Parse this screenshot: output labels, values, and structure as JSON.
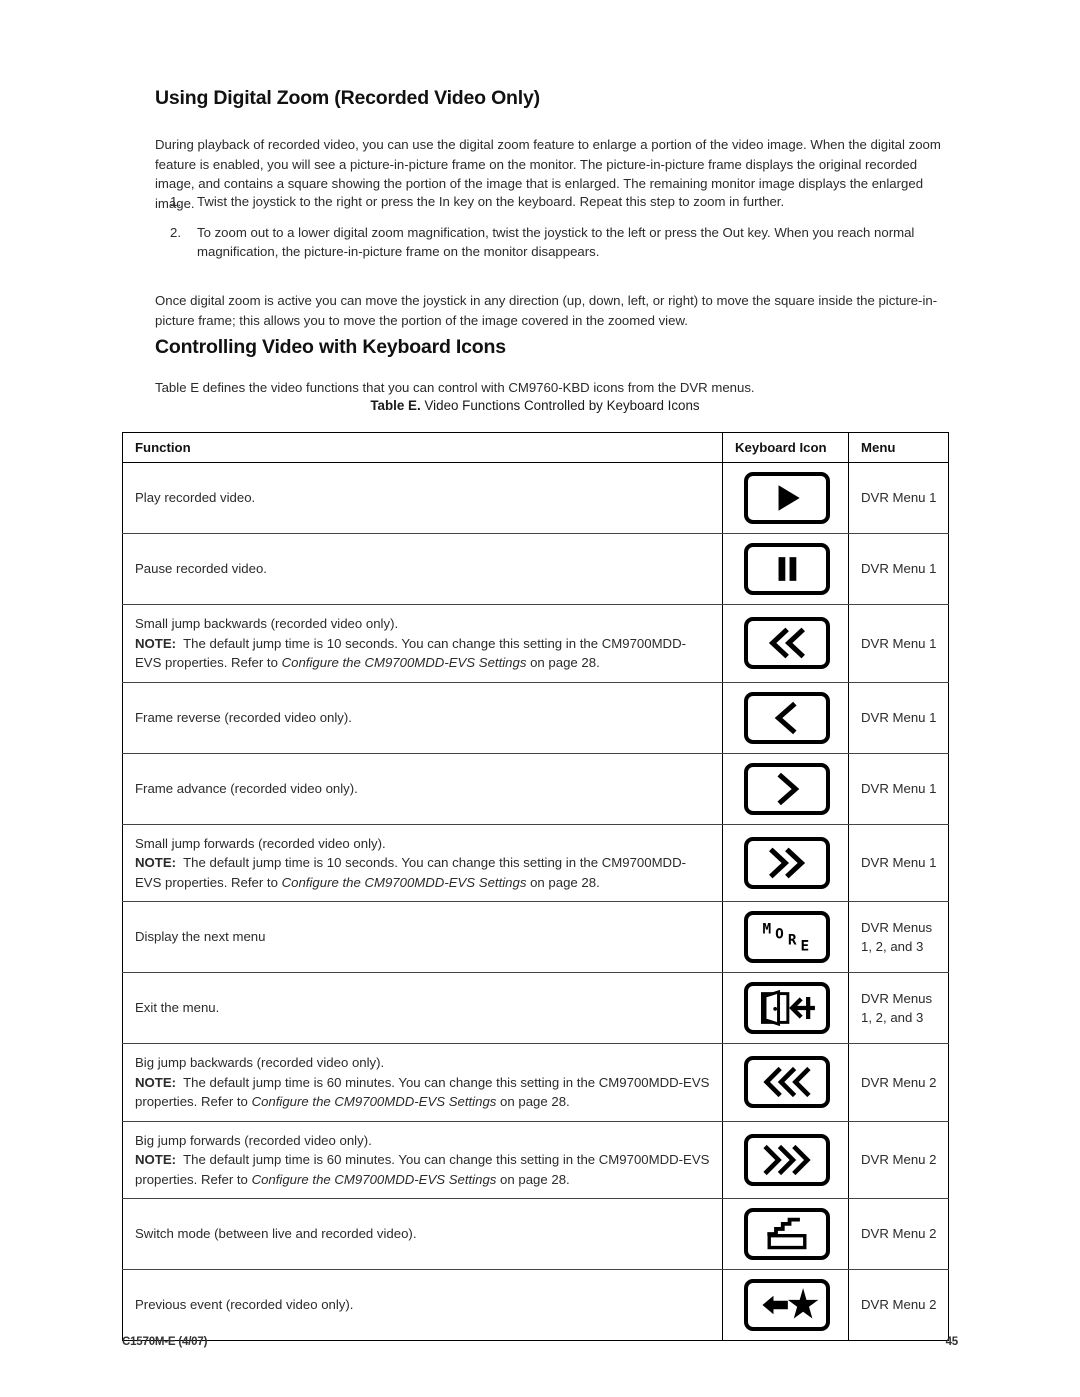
{
  "sections": {
    "zoom": {
      "heading": "Using Digital Zoom (Recorded Video Only)",
      "intro": "During playback of recorded video, you can use the digital zoom feature to enlarge a portion of the video image. When the digital zoom feature is enabled, you will see a picture-in-picture frame on the monitor. The picture-in-picture frame displays the original recorded image, and contains a square showing the portion of the image that is enlarged. The remaining monitor image displays the enlarged image.",
      "steps": [
        {
          "num": "1.",
          "text": "Twist the joystick to the right or press the In key on the keyboard. Repeat this step to zoom in further."
        },
        {
          "num": "2.",
          "text": "To zoom out to a lower digital zoom magnification, twist the joystick to the left or press the Out key. When you reach normal magnification, the picture-in-picture frame on the monitor disappears."
        }
      ],
      "closing": "Once digital zoom is active you can move the joystick in any direction (up, down, left, or right) to move the square inside the picture-in-picture frame; this allows you to move the portion of the image covered in the zoomed view."
    },
    "controlling": {
      "heading": "Controlling Video with Keyboard Icons",
      "intro": "Table E defines the video functions that you can control with CM9760-KBD icons from the DVR menus."
    }
  },
  "table": {
    "caption_label": "Table E.",
    "caption_text": "Video Functions Controlled by Keyboard Icons",
    "columns": [
      "Function",
      "Keyboard Icon",
      "Menu"
    ],
    "rows": [
      {
        "function": "Play recorded video.",
        "note_label": "",
        "note_text": "",
        "note_italic": "",
        "note_tail": "",
        "icon": "play-icon",
        "menu": "DVR Menu 1"
      },
      {
        "function": "Pause recorded video.",
        "note_label": "",
        "note_text": "",
        "note_italic": "",
        "note_tail": "",
        "icon": "pause-icon",
        "menu": "DVR Menu 1"
      },
      {
        "function": "Small jump backwards (recorded video only).",
        "note_label": "NOTE:",
        "note_text": "The default jump time is 10 seconds. You can change this setting in the CM9700MDD-EVS properties. Refer to",
        "note_italic": "Configure the CM9700MDD-EVS Settings",
        "note_tail": "on page 28.",
        "icon": "double-chevron-left-icon",
        "menu": "DVR Menu 1"
      },
      {
        "function": "Frame reverse (recorded video only).",
        "note_label": "",
        "note_text": "",
        "note_italic": "",
        "note_tail": "",
        "icon": "chevron-left-icon",
        "menu": "DVR Menu 1"
      },
      {
        "function": "Frame advance (recorded video only).",
        "note_label": "",
        "note_text": "",
        "note_italic": "",
        "note_tail": "",
        "icon": "chevron-right-icon",
        "menu": "DVR Menu 1"
      },
      {
        "function": "Small jump forwards (recorded video only).",
        "note_label": "NOTE:",
        "note_text": "The default jump time is 10 seconds. You can change this setting in the CM9700MDD-EVS properties. Refer to",
        "note_italic": "Configure the CM9700MDD-EVS Settings",
        "note_tail": "on page 28.",
        "icon": "double-chevron-right-icon",
        "menu": "DVR Menu 1"
      },
      {
        "function": "Display the next menu",
        "note_label": "",
        "note_text": "",
        "note_italic": "",
        "note_tail": "",
        "icon": "more-icon",
        "menu": "DVR Menus 1, 2, and 3"
      },
      {
        "function": "Exit the menu.",
        "note_label": "",
        "note_text": "",
        "note_italic": "",
        "note_tail": "",
        "icon": "exit-door-icon",
        "menu": "DVR Menus 1, 2, and 3"
      },
      {
        "function": "Big jump backwards (recorded video only).",
        "note_label": "NOTE:",
        "note_text": "The default jump time is 60 minutes. You can change this setting in the CM9700MDD-EVS properties. Refer to",
        "note_italic": "Configure the CM9700MDD-EVS Settings",
        "note_tail": "on page 28.",
        "icon": "triple-chevron-left-icon",
        "menu": "DVR Menu 2"
      },
      {
        "function": "Big jump forwards (recorded video only).",
        "note_label": "NOTE:",
        "note_text": "The default jump time is 60 minutes. You can change this setting in the CM9700MDD-EVS properties. Refer to",
        "note_italic": "Configure the CM9700MDD-EVS Settings",
        "note_tail": "on page 28.",
        "icon": "triple-chevron-right-icon",
        "menu": "DVR Menu 2"
      },
      {
        "function": "Switch mode (between live and recorded video).",
        "note_label": "",
        "note_text": "",
        "note_italic": "",
        "note_tail": "",
        "icon": "clapperboard-icon",
        "menu": "DVR Menu 2"
      },
      {
        "function": "Previous event (recorded video only).",
        "note_label": "",
        "note_text": "",
        "note_italic": "",
        "note_tail": "",
        "icon": "previous-event-icon",
        "menu": "DVR Menu 2"
      }
    ]
  },
  "footer": {
    "document_id": "C1570M-E (4/07)",
    "page_number": "45"
  },
  "colors": {
    "text": "#2b2b2b",
    "heading": "#111111",
    "rule": "#000000"
  }
}
